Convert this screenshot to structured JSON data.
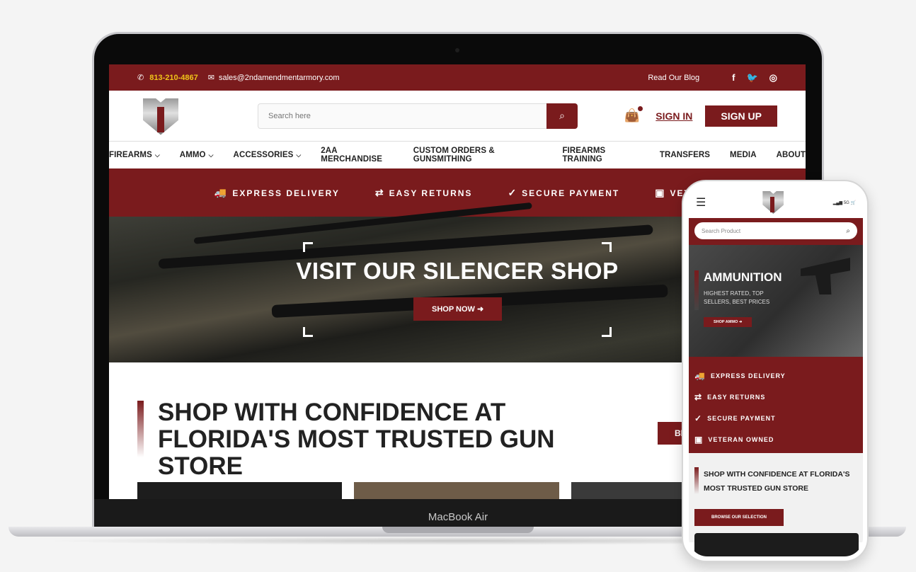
{
  "device": {
    "laptop_label": "MacBook Air"
  },
  "topbar": {
    "phone": "813-210-4867",
    "email": "sales@2ndamendmentarmory.com",
    "blog_link": "Read Our Blog",
    "social": [
      "f",
      "🐦",
      "◎"
    ]
  },
  "header": {
    "search_placeholder": "Search here",
    "sign_in": "SIGN IN",
    "sign_up": "SIGN UP"
  },
  "nav": {
    "items": [
      {
        "label": "FIREARMS",
        "caret": "⌵"
      },
      {
        "label": "AMMO",
        "caret": "⌵"
      },
      {
        "label": "ACCESSORIES",
        "caret": "⌵"
      },
      {
        "label": "2AA MERCHANDISE",
        "caret": ""
      },
      {
        "label": "CUSTOM ORDERS & GUNSMITHING",
        "caret": ""
      },
      {
        "label": "FIREARMS TRAINING",
        "caret": ""
      },
      {
        "label": "TRANSFERS",
        "caret": ""
      },
      {
        "label": "MEDIA",
        "caret": ""
      },
      {
        "label": "ABOUT",
        "caret": ""
      }
    ]
  },
  "features": [
    {
      "icon": "🚚",
      "label": "EXPRESS DELIVERY"
    },
    {
      "icon": "⇄",
      "label": "EASY RETURNS"
    },
    {
      "icon": "✓",
      "label": "SECURE PAYMENT"
    },
    {
      "icon": "▣",
      "label": "VETERAN OWNED"
    }
  ],
  "hero": {
    "title": "VISIT OUR SILENCER SHOP",
    "button": "SHOP NOW ➜"
  },
  "confidence": {
    "title": "SHOP WITH CONFIDENCE AT FLORIDA'S MOST TRUSTED GUN STORE",
    "button_partial": "BR"
  },
  "phone": {
    "status": "5G",
    "search_placeholder": "Search Product",
    "hero_title": "AMMUNITION",
    "hero_sub": "HIGHEST RATED, TOP SELLERS, BEST PRICES",
    "hero_button": "SHOP AMMO ➜",
    "conf_title": "SHOP WITH CONFIDENCE AT FLORIDA'S MOST TRUSTED GUN STORE",
    "conf_button": "BROWSE OUR SELECTION"
  },
  "colors": {
    "brand": "#7a1b1d",
    "accent_phone_text": "#f0c419"
  }
}
